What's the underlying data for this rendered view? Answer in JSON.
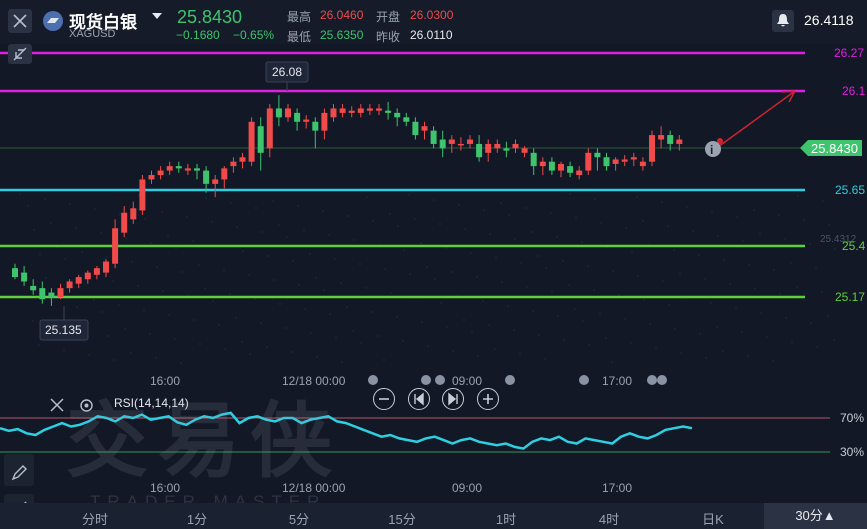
{
  "header": {
    "symbol_name": "现货白银",
    "symbol_code": "XAGUSD",
    "price": "25.8430",
    "change_abs": "−0.1680",
    "change_pct": "−0.65%",
    "stats": {
      "high_label": "最高",
      "high_value": "26.0460",
      "open_label": "开盘",
      "open_value": "26.0300",
      "low_label": "最低",
      "low_value": "25.6350",
      "prev_close_label": "昨收",
      "prev_close_value": "26.0110"
    },
    "top_price_label": "26.4118"
  },
  "price_lines": [
    {
      "label": "26.27",
      "color": "#e020e0"
    },
    {
      "label": "26.1",
      "color": "#e020e0"
    },
    {
      "label": "25.65",
      "color": "#2ecfe0"
    },
    {
      "label": "25.4",
      "color": "#5ed13a"
    },
    {
      "label": "25.17",
      "color": "#5ed13a"
    }
  ],
  "current_price_tag": "25.8430",
  "hidden_axis_label": "25.4312",
  "high_marker": "26.08",
  "low_marker": "25.135",
  "time_axis": [
    "16:00",
    "12/18 00:00",
    "09:00",
    "17:00"
  ],
  "rsi": {
    "title": "RSI(14,14,14)",
    "level_high": "70%",
    "level_low": "30%"
  },
  "watermark": {
    "main": "交易侠",
    "sub": "TRADER MASTER"
  },
  "timeframe_tabs": [
    {
      "label": "分时"
    },
    {
      "label": "1分"
    },
    {
      "label": "5分"
    },
    {
      "label": "15分"
    },
    {
      "label": "1时"
    },
    {
      "label": "4时"
    },
    {
      "label": "日K"
    },
    {
      "label": "30分▲"
    }
  ],
  "active_tab": "30分▲",
  "colors": {
    "up": "#ef4b4b",
    "down": "#3ec46d",
    "background": "#121826",
    "rsi_line": "#2ecfe0"
  },
  "chart_data": {
    "type": "candlestick",
    "symbol": "XAGUSD",
    "y_range": [
      25.1,
      26.3
    ],
    "candles": [
      [
        25.3,
        25.32,
        25.26,
        25.25
      ],
      [
        25.28,
        25.31,
        25.24,
        25.22
      ],
      [
        25.22,
        25.25,
        25.2,
        25.18
      ],
      [
        25.21,
        25.24,
        25.16,
        25.14
      ],
      [
        25.19,
        25.21,
        25.17,
        25.13
      ],
      [
        25.17,
        25.23,
        25.21,
        25.16
      ],
      [
        25.21,
        25.25,
        25.24,
        25.19
      ],
      [
        25.23,
        25.27,
        25.26,
        25.21
      ],
      [
        25.25,
        25.29,
        25.28,
        25.23
      ],
      [
        25.27,
        25.31,
        25.3,
        25.25
      ],
      [
        25.28,
        25.34,
        25.33,
        25.26
      ],
      [
        25.32,
        25.52,
        25.48,
        25.3
      ],
      [
        25.46,
        25.58,
        25.55,
        25.44
      ],
      [
        25.52,
        25.6,
        25.57,
        25.5
      ],
      [
        25.56,
        25.72,
        25.7,
        25.54
      ],
      [
        25.7,
        25.74,
        25.72,
        25.68
      ],
      [
        25.72,
        25.76,
        25.74,
        25.7
      ],
      [
        25.74,
        25.78,
        25.76,
        25.72
      ],
      [
        25.76,
        25.78,
        25.75,
        25.73
      ],
      [
        25.74,
        25.77,
        25.75,
        25.72
      ],
      [
        25.75,
        25.77,
        25.74,
        25.7
      ],
      [
        25.74,
        25.76,
        25.68,
        25.64
      ],
      [
        25.68,
        25.72,
        25.7,
        25.62
      ],
      [
        25.7,
        25.76,
        25.75,
        25.66
      ],
      [
        25.76,
        25.8,
        25.78,
        25.73
      ],
      [
        25.78,
        25.82,
        25.8,
        25.75
      ],
      [
        25.78,
        25.98,
        25.96,
        25.76
      ],
      [
        25.94,
        25.98,
        25.82,
        25.74
      ],
      [
        25.84,
        26.04,
        26.02,
        25.8
      ],
      [
        26.02,
        26.08,
        25.98,
        25.94
      ],
      [
        25.98,
        26.04,
        26.02,
        25.96
      ],
      [
        26.0,
        26.02,
        25.96,
        25.92
      ],
      [
        25.96,
        25.99,
        25.97,
        25.93
      ],
      [
        25.96,
        25.98,
        25.92,
        25.84
      ],
      [
        25.92,
        26.02,
        26.0,
        25.88
      ],
      [
        25.98,
        26.04,
        26.02,
        25.96
      ],
      [
        26.0,
        26.04,
        26.02,
        25.98
      ],
      [
        26.0,
        26.03,
        26.01,
        25.98
      ],
      [
        26.0,
        26.04,
        26.02,
        25.98
      ],
      [
        26.01,
        26.04,
        26.02,
        25.99
      ],
      [
        26.01,
        26.04,
        26.02,
        25.99
      ],
      [
        26.01,
        26.05,
        26.0,
        25.97
      ],
      [
        26.0,
        26.02,
        25.98,
        25.94
      ],
      [
        25.98,
        26.0,
        25.96,
        25.94
      ],
      [
        25.96,
        25.98,
        25.9,
        25.88
      ],
      [
        25.92,
        25.96,
        25.94,
        25.88
      ],
      [
        25.92,
        25.94,
        25.86,
        25.84
      ],
      [
        25.88,
        25.92,
        25.84,
        25.8
      ],
      [
        25.86,
        25.9,
        25.88,
        25.82
      ],
      [
        25.86,
        25.89,
        25.86,
        25.83
      ],
      [
        25.86,
        25.9,
        25.88,
        25.84
      ],
      [
        25.86,
        25.9,
        25.8,
        25.78
      ],
      [
        25.82,
        25.88,
        25.86,
        25.78
      ],
      [
        25.84,
        25.88,
        25.86,
        25.82
      ],
      [
        25.84,
        25.87,
        25.83,
        25.8
      ],
      [
        25.84,
        25.88,
        25.86,
        25.82
      ],
      [
        25.82,
        25.85,
        25.84,
        25.8
      ],
      [
        25.82,
        25.84,
        25.76,
        25.72
      ],
      [
        25.76,
        25.8,
        25.78,
        25.72
      ],
      [
        25.78,
        25.8,
        25.74,
        25.72
      ],
      [
        25.74,
        25.78,
        25.77,
        25.71
      ],
      [
        25.76,
        25.78,
        25.73,
        25.71
      ],
      [
        25.72,
        25.76,
        25.74,
        25.7
      ],
      [
        25.74,
        25.84,
        25.82,
        25.72
      ],
      [
        25.82,
        25.84,
        25.8,
        25.74
      ],
      [
        25.8,
        25.82,
        25.76,
        25.74
      ],
      [
        25.77,
        25.8,
        25.79,
        25.74
      ],
      [
        25.78,
        25.81,
        25.79,
        25.76
      ],
      [
        25.79,
        25.82,
        25.8,
        25.76
      ],
      [
        25.76,
        25.8,
        25.78,
        25.74
      ],
      [
        25.78,
        25.92,
        25.9,
        25.76
      ],
      [
        25.88,
        25.94,
        25.9,
        25.84
      ],
      [
        25.9,
        25.92,
        25.86,
        25.83
      ],
      [
        25.86,
        25.9,
        25.88,
        25.83
      ]
    ],
    "rsi_series": [
      58,
      55,
      57,
      52,
      50,
      56,
      60,
      64,
      60,
      62,
      66,
      72,
      70,
      66,
      72,
      70,
      74,
      68,
      70,
      72,
      65,
      62,
      68,
      72,
      70,
      74,
      76,
      64,
      70,
      72,
      68,
      66,
      70,
      70,
      64,
      68,
      70,
      72,
      66,
      64,
      60,
      56,
      52,
      48,
      50,
      46,
      44,
      42,
      46,
      48,
      44,
      40,
      44,
      46,
      42,
      40,
      38,
      40,
      36,
      34,
      42,
      46,
      44,
      48,
      42,
      40,
      46,
      44,
      42,
      40,
      48,
      52,
      48,
      46,
      50,
      56,
      58,
      60,
      58
    ]
  }
}
